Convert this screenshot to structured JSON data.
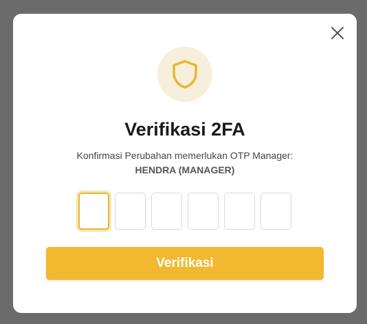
{
  "dialog": {
    "title": "Verifikasi 2FA",
    "subtitle": "Konfirmasi Perubahan memerlukan OTP Manager:",
    "manager": "HENDRA (MANAGER)",
    "close_icon": "close-icon",
    "header_icon": "shield-icon"
  },
  "otp": {
    "digits": [
      "",
      "",
      "",
      "",
      "",
      ""
    ],
    "active_index": 0
  },
  "actions": {
    "verify_label": "Verifikasi"
  },
  "colors": {
    "accent": "#f2b830",
    "shield": "#e8b730",
    "shield_bg": "#f7efdc",
    "overlay": "#6b6b6b"
  }
}
